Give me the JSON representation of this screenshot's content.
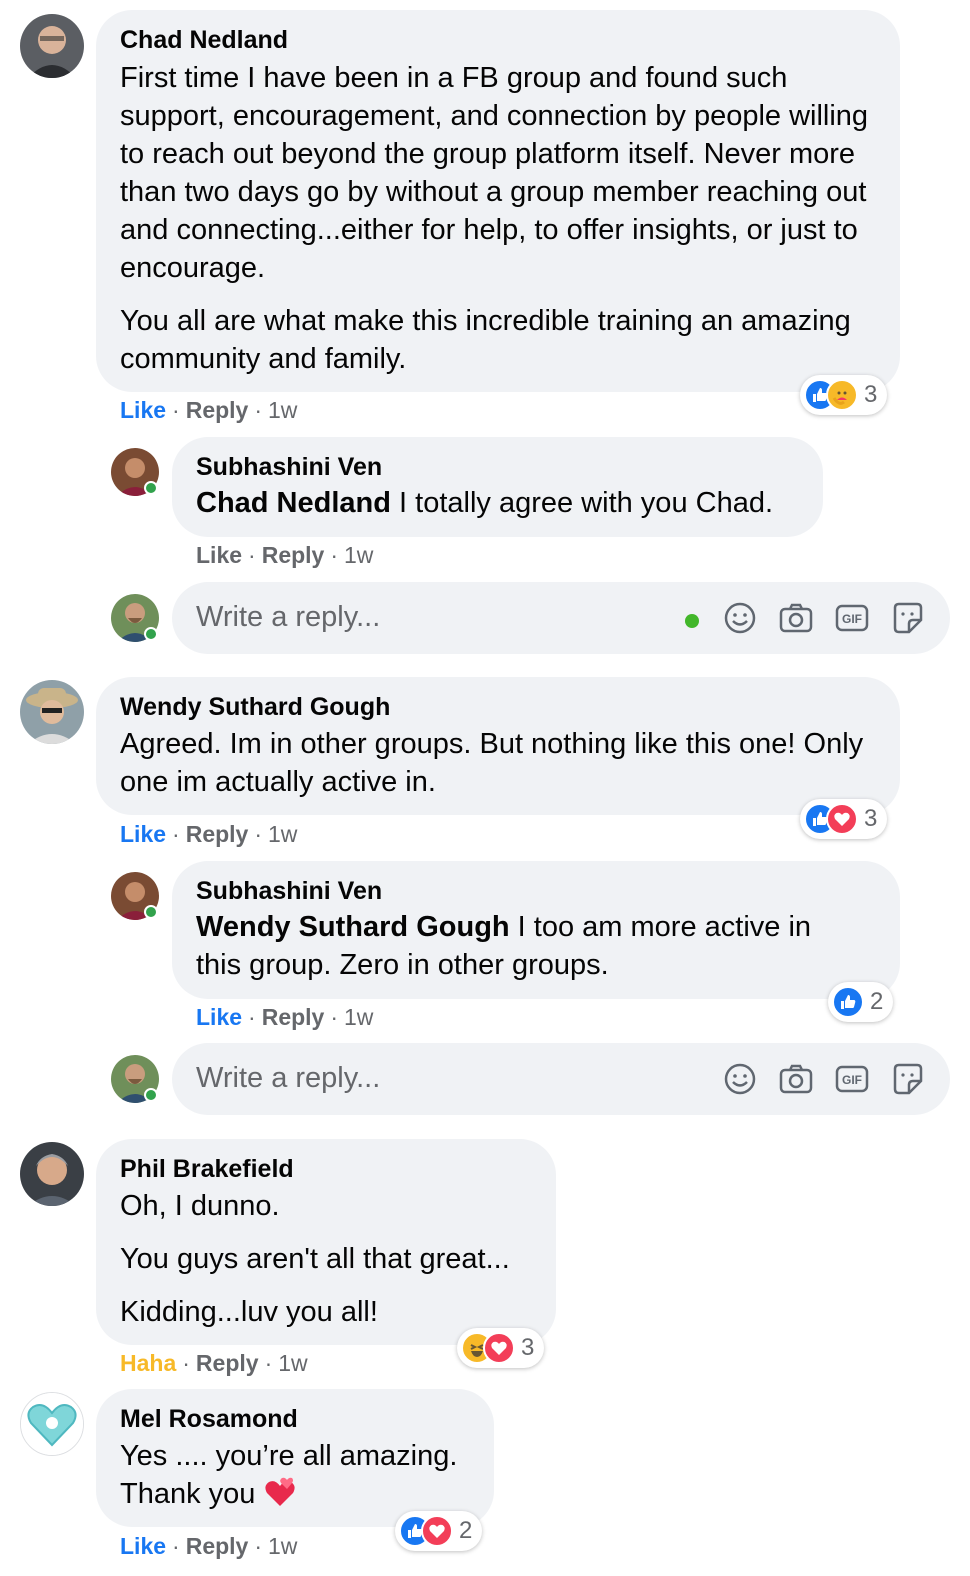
{
  "comments": [
    {
      "author": "Chad Nedland",
      "paragraphs": [
        "First time I have been in a FB group and found such support, encouragement, and connection by people willing to reach out beyond the group platform itself. Never more than two days go by without a group member reaching out and connecting...either for help, to offer insights, or just to encourage.",
        "You all are what make this incredible training an amazing community and family."
      ],
      "action_reaction": "Like",
      "reply_label": "Reply",
      "time": "1w",
      "reaction_count": "3",
      "reactions": [
        "like-emoji",
        "care-emoji"
      ]
    },
    {
      "author": "Subhashini Ven",
      "mention": "Chad Nedland",
      "text": " I totally agree with you Chad.",
      "action_reaction": "Like",
      "reply_label": "Reply",
      "time": "1w"
    },
    {
      "author": "Wendy Suthard Gough",
      "paragraphs": [
        "Agreed. Im in other groups. But nothing like this one! Only one im actually active in."
      ],
      "action_reaction": "Like",
      "reply_label": "Reply",
      "time": "1w",
      "reaction_count": "3",
      "reactions": [
        "like-emoji",
        "love-emoji"
      ]
    },
    {
      "author": "Subhashini Ven",
      "mention": "Wendy Suthard Gough",
      "text": " I too am more active in this group. Zero in other groups.",
      "action_reaction": "Like",
      "reply_label": "Reply",
      "time": "1w",
      "reaction_count": "2",
      "reactions": [
        "like-emoji"
      ]
    },
    {
      "author": "Phil Brakefield",
      "paragraphs": [
        "Oh, I dunno.",
        "You guys aren't all that great...",
        "Kidding...luv you all!"
      ],
      "action_reaction": "Haha",
      "reply_label": "Reply",
      "time": "1w",
      "reaction_count": "3",
      "reactions": [
        "haha-emoji",
        "love-emoji"
      ]
    },
    {
      "author": "Mel Rosamond",
      "paragraphs": [
        "Yes .... you’re all amazing.",
        "Thank you"
      ],
      "action_reaction": "Like",
      "reply_label": "Reply",
      "time": "1w",
      "reaction_count": "2",
      "reactions": [
        "like-emoji",
        "love-emoji"
      ]
    }
  ],
  "reply_box": {
    "placeholder": "Write a reply..."
  },
  "colors": {
    "bubble": "#f0f2f5",
    "link_blue": "#1877f2",
    "haha_yellow": "#f7b928",
    "meta_gray": "#65676b",
    "online_green": "#31a24c"
  },
  "icons": [
    "emoji-icon",
    "camera-icon",
    "gif-icon",
    "sticker-icon",
    "heart-emoji"
  ]
}
